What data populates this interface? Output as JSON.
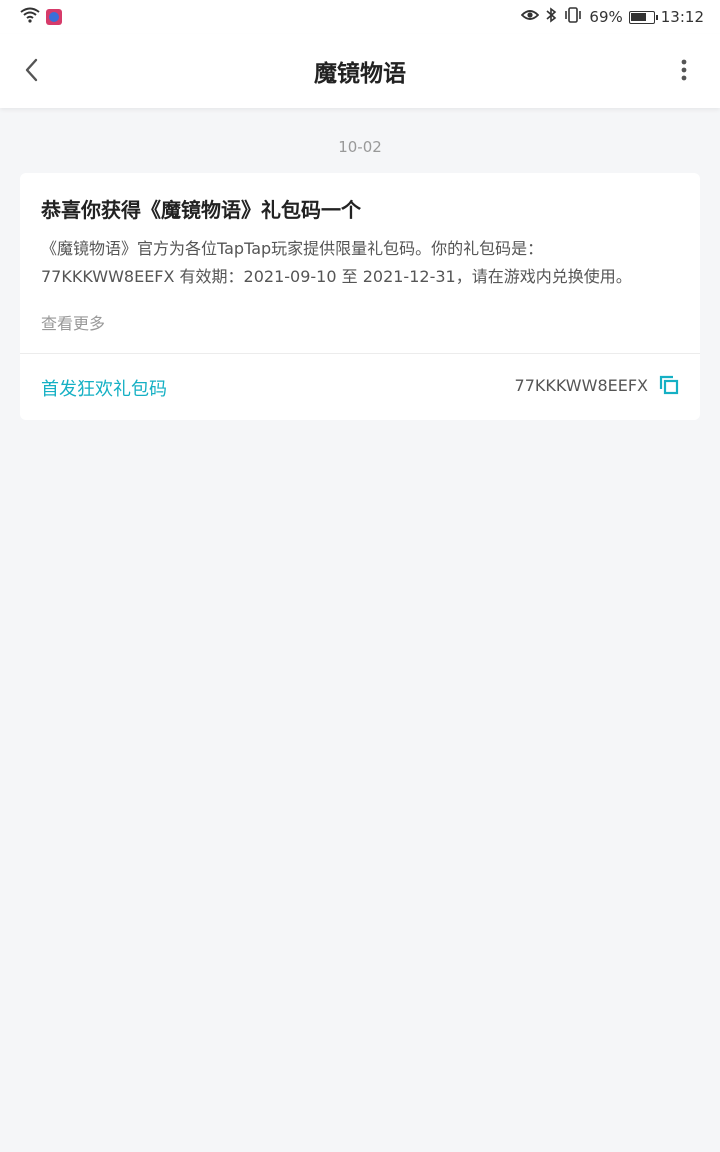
{
  "status_bar": {
    "battery_percent": "69%",
    "time": "13:12"
  },
  "header": {
    "title": "魔镜物语"
  },
  "message": {
    "date": "10-02",
    "title": "恭喜你获得《魔镜物语》礼包码一个",
    "body_line1": "《魔镜物语》官方为各位TapTap玩家提供限量礼包码。你的礼包码是：",
    "body_line2": "77KKKWW8EEFX 有效期：2021-09-10 至 2021-12-31，请在游戏内兑换使用。",
    "see_more": "查看更多",
    "gift_name": "首发狂欢礼包码",
    "gift_code": "77KKKWW8EEFX"
  },
  "colors": {
    "accent": "#15b0c4",
    "background": "#f5f6f8"
  }
}
